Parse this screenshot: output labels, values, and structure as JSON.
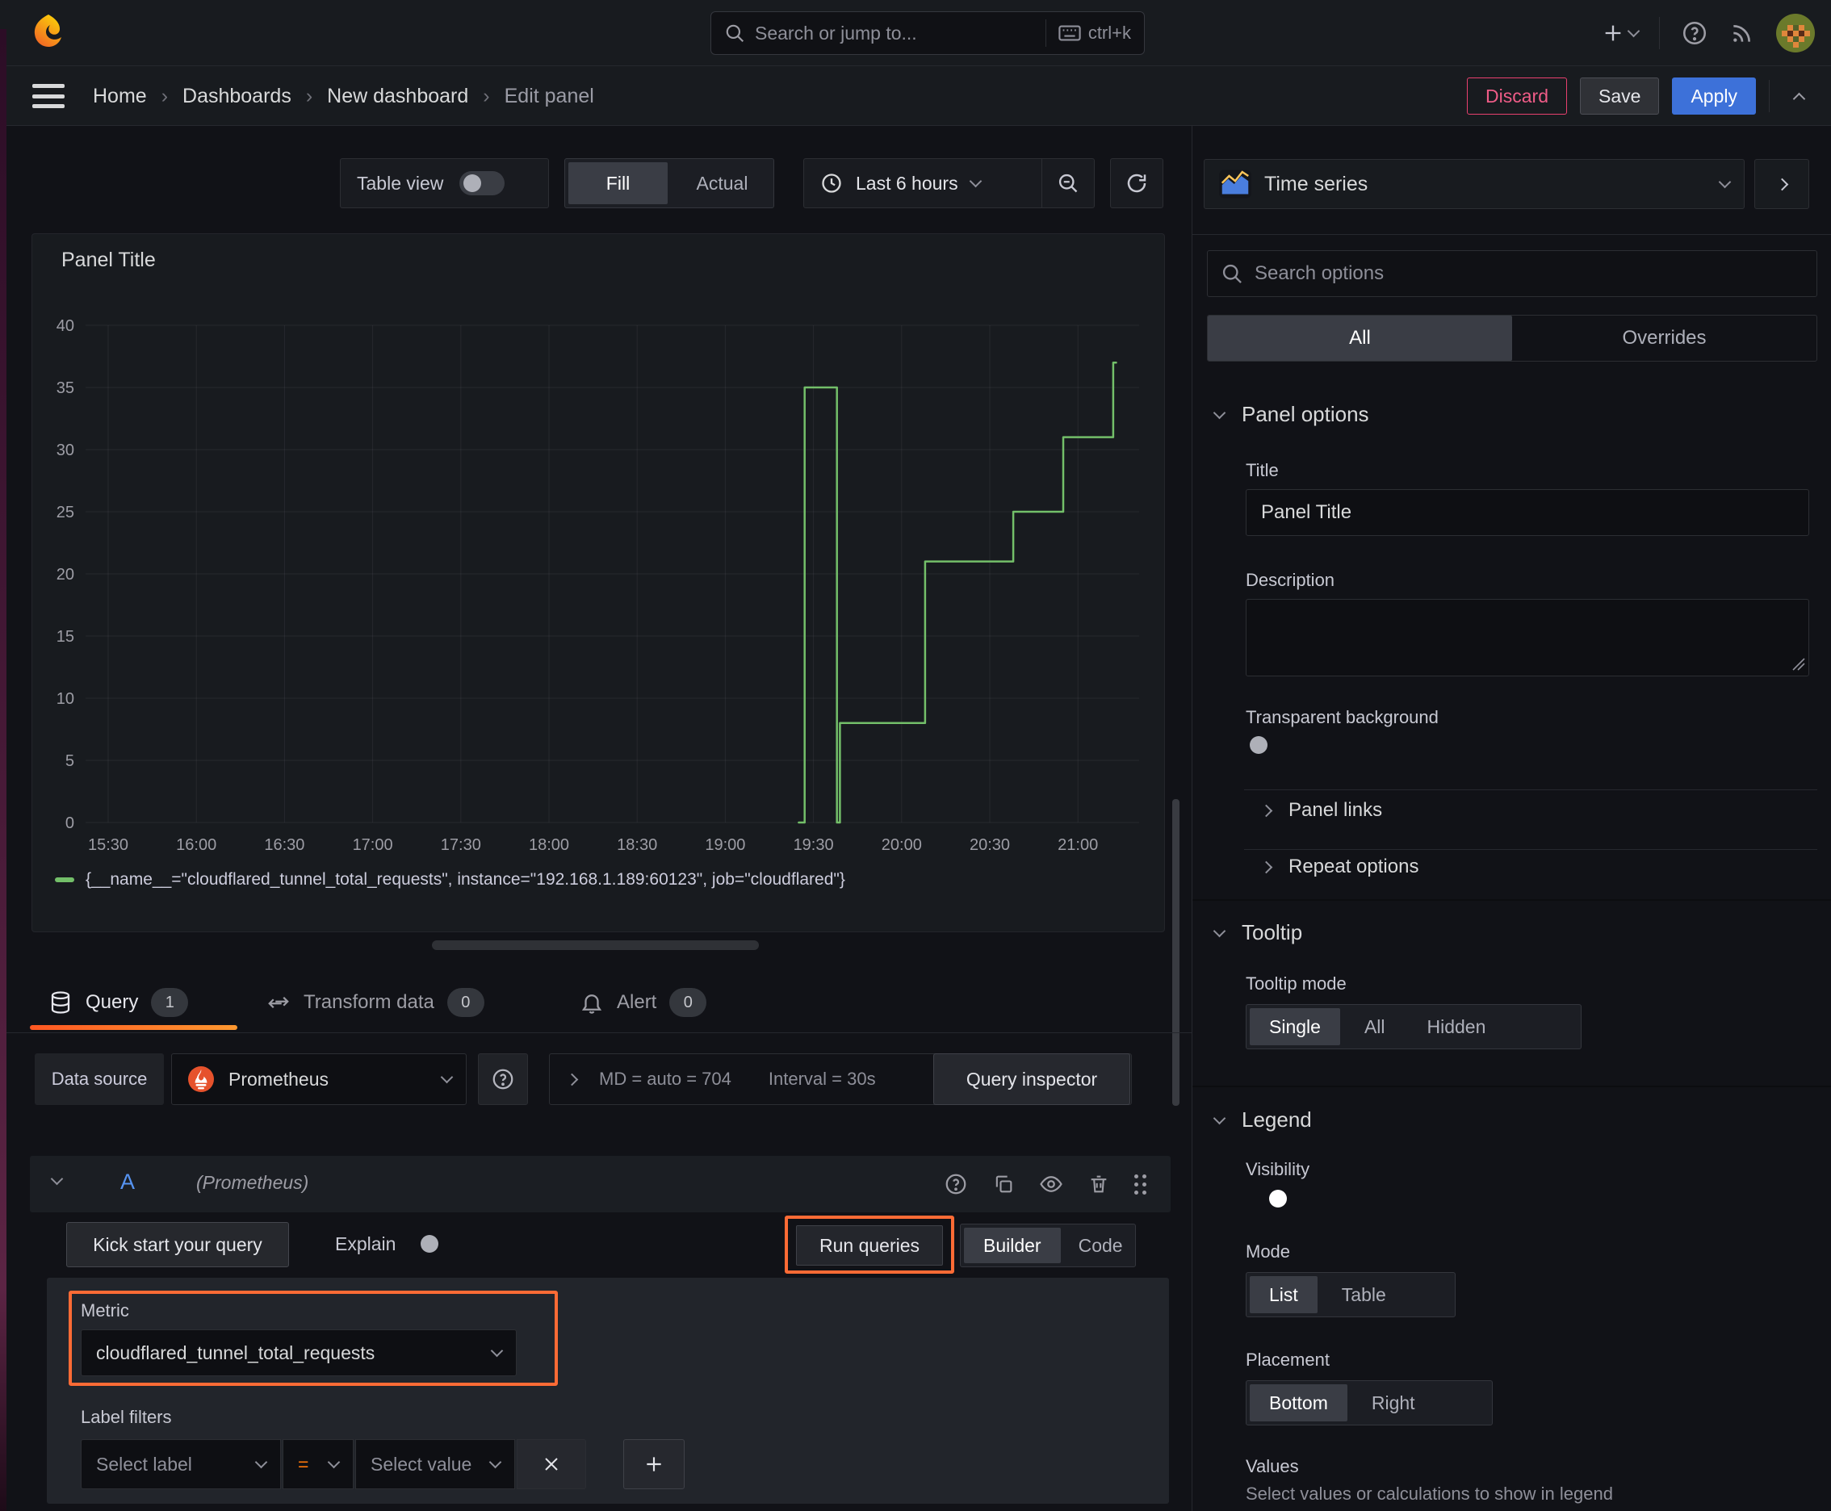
{
  "topbar": {
    "search_placeholder": "Search or jump to...",
    "search_shortcut": "ctrl+k"
  },
  "breadcrumb": {
    "items": [
      "Home",
      "Dashboards",
      "New dashboard",
      "Edit panel"
    ],
    "discard": "Discard",
    "save": "Save",
    "apply": "Apply"
  },
  "toolbar": {
    "table_view": "Table view",
    "fill": "Fill",
    "actual": "Actual",
    "time_range": "Last 6 hours"
  },
  "panel": {
    "title": "Panel Title"
  },
  "chart_data": {
    "type": "line",
    "step": true,
    "title": "Panel Title",
    "series_name": "{__name__=\"cloudflared_tunnel_total_requests\", instance=\"192.168.1.189:60123\", job=\"cloudflared\"}",
    "color": "#73bf69",
    "ylim": [
      0,
      40
    ],
    "y_ticks": [
      0,
      5,
      10,
      15,
      20,
      25,
      30,
      35,
      40
    ],
    "x_ticks": [
      "15:30",
      "16:00",
      "16:30",
      "17:00",
      "17:30",
      "18:00",
      "18:30",
      "19:00",
      "19:30",
      "20:00",
      "20:30",
      "21:00"
    ],
    "points": [
      [
        "19:25",
        0
      ],
      [
        "19:27",
        0
      ],
      [
        "19:27",
        35
      ],
      [
        "19:38",
        35
      ],
      [
        "19:38",
        0
      ],
      [
        "19:39",
        0
      ],
      [
        "19:39",
        8
      ],
      [
        "20:08",
        8
      ],
      [
        "20:08",
        21
      ],
      [
        "20:38",
        21
      ],
      [
        "20:38",
        25
      ],
      [
        "20:55",
        25
      ],
      [
        "20:55",
        31
      ],
      [
        "21:12",
        31
      ],
      [
        "21:12",
        37
      ],
      [
        "21:13",
        37
      ]
    ],
    "legend_position": "bottom",
    "grid": true
  },
  "tabs": {
    "query": {
      "label": "Query",
      "badge": "1"
    },
    "transform": {
      "label": "Transform data",
      "badge": "0"
    },
    "alert": {
      "label": "Alert",
      "badge": "0"
    }
  },
  "datasource": {
    "label": "Data source",
    "name": "Prometheus",
    "stats_md": "MD = auto = 704",
    "stats_interval": "Interval = 30s",
    "inspector": "Query inspector"
  },
  "query": {
    "ref": "A",
    "ds_hint": "(Prometheus)",
    "kick_start": "Kick start your query",
    "explain": "Explain",
    "run": "Run queries",
    "builder": "Builder",
    "code": "Code",
    "metric_label": "Metric",
    "metric_value": "cloudflared_tunnel_total_requests",
    "label_filters": "Label filters",
    "select_label": "Select label",
    "operator": "=",
    "select_value": "Select value"
  },
  "sidebar": {
    "viz_name": "Time series",
    "search_placeholder": "Search options",
    "tab_all": "All",
    "tab_overrides": "Overrides",
    "panel_options": {
      "header": "Panel options",
      "title_label": "Title",
      "title_value": "Panel Title",
      "description_label": "Description",
      "transparent_label": "Transparent background"
    },
    "links_header": "Panel links",
    "repeat_header": "Repeat options",
    "tooltip": {
      "header": "Tooltip",
      "mode_label": "Tooltip mode",
      "single": "Single",
      "all": "All",
      "hidden": "Hidden"
    },
    "legend": {
      "header": "Legend",
      "visibility_label": "Visibility",
      "mode_label": "Mode",
      "list": "List",
      "table": "Table",
      "placement_label": "Placement",
      "bottom": "Bottom",
      "right": "Right",
      "values_label": "Values",
      "values_help": "Select values or calculations to show in legend"
    }
  },
  "colors": {
    "accent_orange": "#ff6b35",
    "series_green": "#73bf69",
    "primary_blue": "#3d71d9",
    "discard_pink": "#ee4f83",
    "tab_underline_from": "#ff5722",
    "tab_underline_to": "#ff9830"
  }
}
